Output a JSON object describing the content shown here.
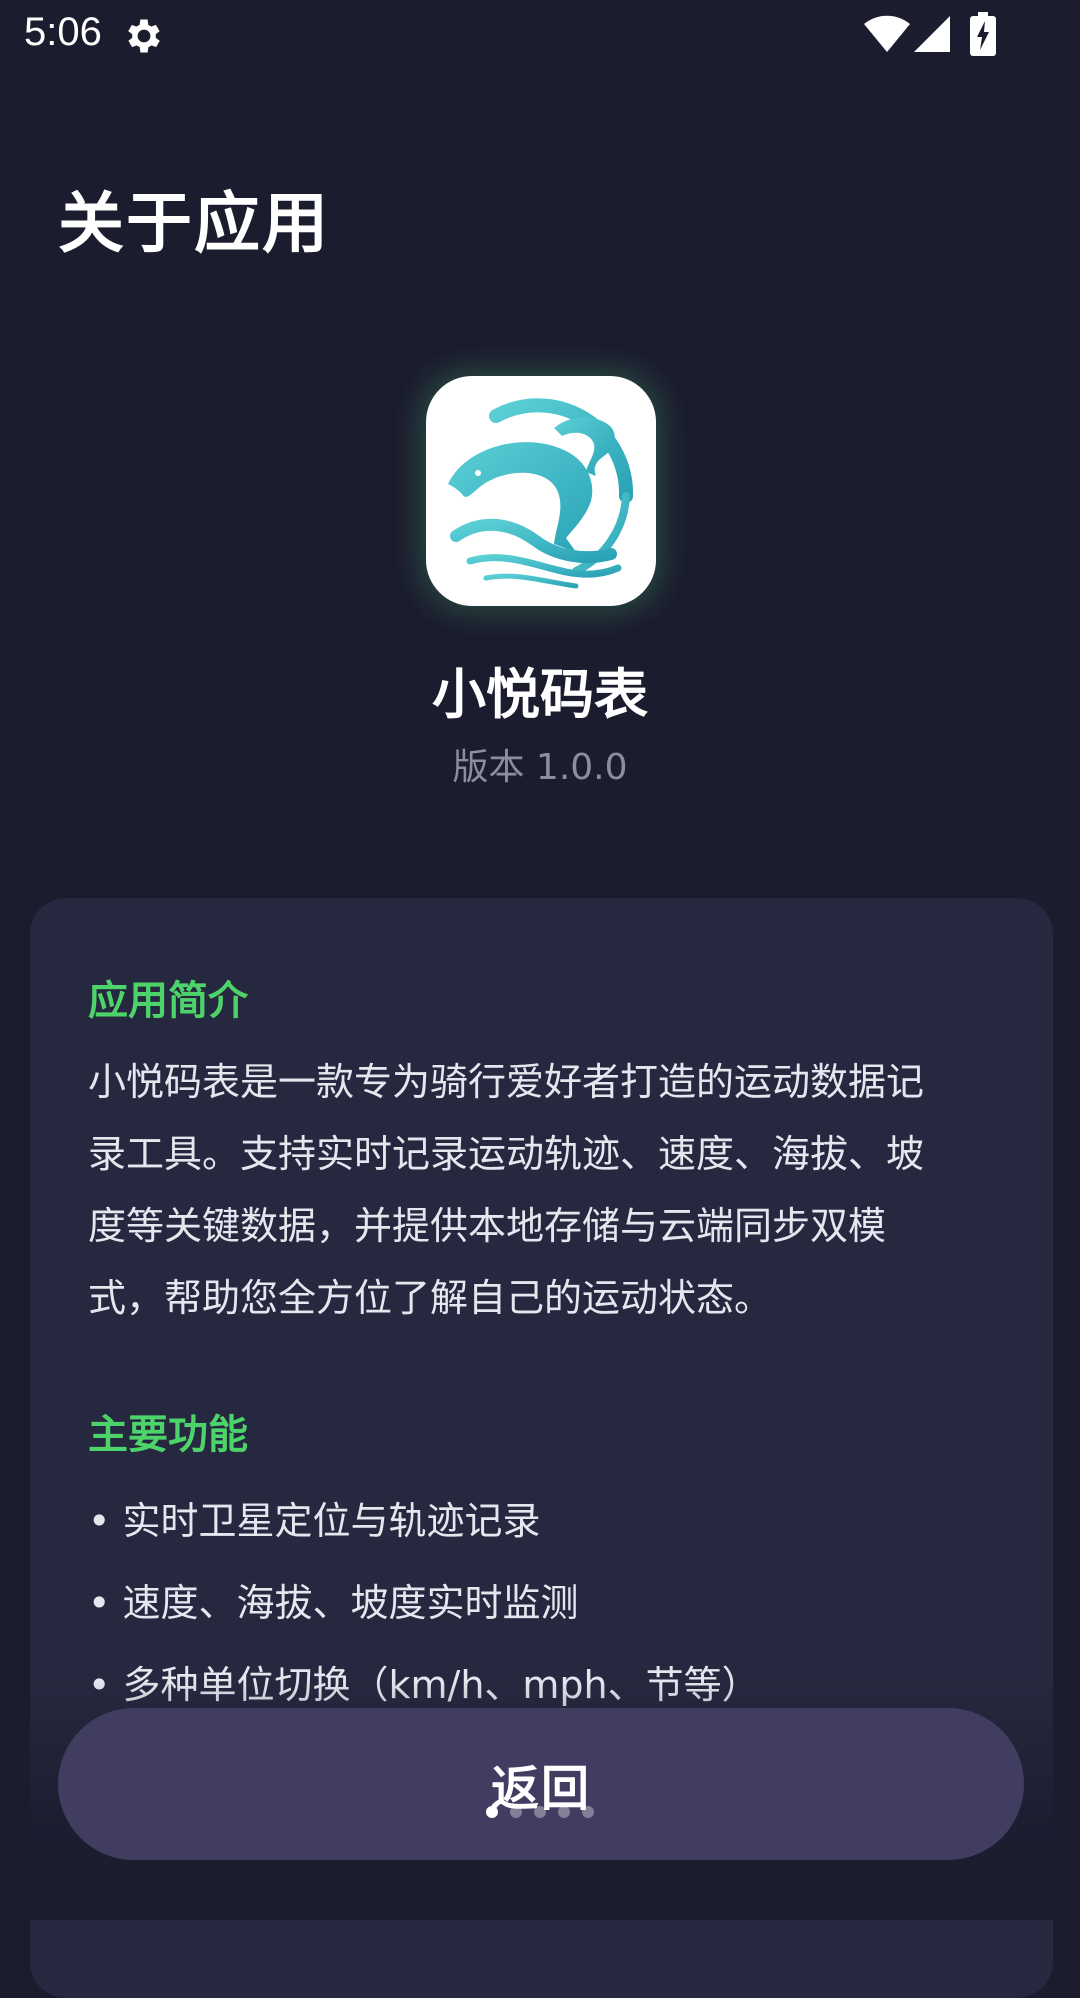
{
  "status_bar": {
    "time": "5:06",
    "icons": [
      "gear-icon",
      "wifi-icon",
      "signal-icon",
      "battery-charging-icon"
    ]
  },
  "page": {
    "title": "关于应用"
  },
  "app": {
    "name": "小悦码表",
    "version": "版本 1.0.0",
    "icon": "dolphin-logo-icon"
  },
  "intro": {
    "title": "应用简介",
    "lines": [
      "小悦码表是一款专为骑行爱好者打造的运动数据记",
      "录工具。支持实时记录运动轨迹、速度、海拔、坡",
      "度等关键数据，并提供本地存储与云端同步双模",
      "式，帮助您全方位了解自己的运动状态。"
    ]
  },
  "features": {
    "title": "主要功能",
    "items": [
      "• 实时卫星定位与轨迹记录",
      "• 速度、海拔、坡度实时监测",
      "• 多种单位切换（km/h、mph、节等）"
    ]
  },
  "footer": {
    "back_label": "返回",
    "page_indicator": {
      "total": 5,
      "current": 1
    }
  },
  "colors": {
    "background": "#1b1c2e",
    "card": "#26283f",
    "accent": "#4cd46a",
    "button": "#403d60",
    "logo_teal": "#3bb7c4"
  }
}
